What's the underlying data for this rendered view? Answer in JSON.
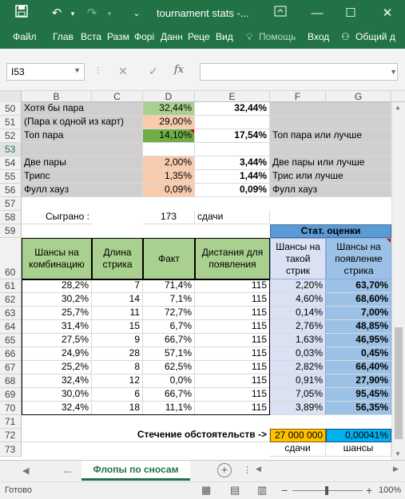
{
  "window": {
    "title": "tournament stats -...",
    "save_icon": "save-icon",
    "undo_icon": "undo-icon",
    "redo_icon": "redo-icon"
  },
  "ribbon": {
    "tabs": [
      "Файл",
      "Глав",
      "Вста",
      "Разм",
      "Форі",
      "Данн",
      "Реце",
      "Вид"
    ],
    "help": "Помощь",
    "login": "Вход",
    "share": "Общий д"
  },
  "formula_bar": {
    "name_box": "I53",
    "cancel_icon": "✕",
    "enter_icon": "✓",
    "fx": "fx",
    "formula": ""
  },
  "columns": [
    "B",
    "C",
    "D",
    "E",
    "F",
    "G"
  ],
  "sheet": {
    "r50": {
      "row": "50",
      "b": "Хотя бы пара",
      "d": "32,44%",
      "e": "32,44%"
    },
    "r51": {
      "row": "51",
      "b": "(Пара к одной из карт)",
      "d": "29,00%"
    },
    "r52": {
      "row": "52",
      "b": "Топ пара",
      "d": "14,10%",
      "e": "17,54%",
      "f": "Топ пара или лучше"
    },
    "r53": {
      "row": "53"
    },
    "r54": {
      "row": "54",
      "b": "Две пары",
      "d": "2,00%",
      "e": "3,44%",
      "f": "Две пары или лучше"
    },
    "r55": {
      "row": "55",
      "b": "Трипс",
      "d": "1,35%",
      "e": "1,44%",
      "f": "Трис или лучше"
    },
    "r56": {
      "row": "56",
      "b": "Фулл хауз",
      "d": "0,09%",
      "e": "0,09%",
      "f": "Фулл хауз"
    },
    "r57": {
      "row": "57"
    },
    "r58": {
      "row": "58",
      "b": "Сыграно :",
      "d": "173",
      "e": "сдачи"
    },
    "r59": {
      "row": "59",
      "fg": "Стат. оценки"
    },
    "r60": {
      "row": "60",
      "b": "Шансы на комбинацию",
      "c": "Длина стрика",
      "d": "Факт",
      "e": "Дистания для появления",
      "f": "Шансы на такой стрик",
      "g": "Шансы на появление стрика"
    },
    "data_rows": [
      {
        "row": "61",
        "b": "28,2%",
        "c": "7",
        "d": "71,4%",
        "e": "115",
        "f": "2,20%",
        "g": "63,70%"
      },
      {
        "row": "62",
        "b": "30,2%",
        "c": "14",
        "d": "7,1%",
        "e": "115",
        "f": "4,60%",
        "g": "68,60%"
      },
      {
        "row": "63",
        "b": "25,7%",
        "c": "11",
        "d": "72,7%",
        "e": "115",
        "f": "0,14%",
        "g": "7,00%"
      },
      {
        "row": "64",
        "b": "31,4%",
        "c": "15",
        "d": "6,7%",
        "e": "115",
        "f": "2,76%",
        "g": "48,85%"
      },
      {
        "row": "65",
        "b": "27,5%",
        "c": "9",
        "d": "66,7%",
        "e": "115",
        "f": "1,63%",
        "g": "46,95%"
      },
      {
        "row": "66",
        "b": "24,9%",
        "c": "28",
        "d": "57,1%",
        "e": "115",
        "f": "0,03%",
        "g": "0,45%"
      },
      {
        "row": "67",
        "b": "25,2%",
        "c": "8",
        "d": "62,5%",
        "e": "115",
        "f": "2,82%",
        "g": "66,40%"
      },
      {
        "row": "68",
        "b": "32,4%",
        "c": "12",
        "d": "0,0%",
        "e": "115",
        "f": "0,91%",
        "g": "27,90%"
      },
      {
        "row": "69",
        "b": "30,0%",
        "c": "6",
        "d": "66,7%",
        "e": "115",
        "f": "7,05%",
        "g": "95,45%"
      },
      {
        "row": "70",
        "b": "32,4%",
        "c": "18",
        "d": "11,1%",
        "e": "115",
        "f": "3,89%",
        "g": "56,35%"
      }
    ],
    "r71": {
      "row": "71"
    },
    "r72": {
      "row": "72",
      "label": "Стечение обстоятельств ->",
      "f": "27 000 000",
      "g": "0,00041%"
    },
    "r73": {
      "row": "73",
      "f": "сдачи",
      "g": "шансы"
    }
  },
  "sheet_tabs": {
    "prev": "◀",
    "ellipsis": "...",
    "active": "Флопы по сносам",
    "add": "+"
  },
  "status": {
    "ready": "Готово",
    "zoom_out": "−",
    "zoom_in": "+",
    "zoom": "100%"
  },
  "colors": {
    "excel_green": "#217346",
    "header_gray": "#d0cece",
    "light_green": "#a9d08e",
    "green": "#70ad47",
    "peach": "#f8cbad",
    "lavender": "#d9e1f2",
    "blue": "#9bc2e6",
    "stat_header": "#5b9bd5",
    "orange": "#ffc000",
    "cyan": "#00b0f0"
  }
}
